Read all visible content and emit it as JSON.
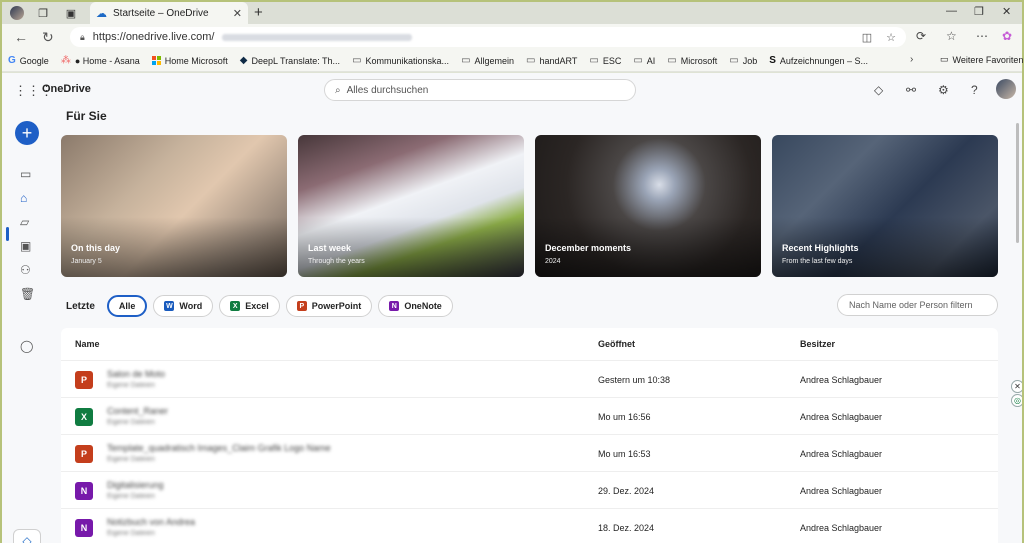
{
  "browser": {
    "tab_title": "Startseite – OneDrive",
    "url": "https://onedrive.live.com/",
    "bookmarks": [
      "Google",
      "● Home - Asana",
      "Home Microsoft",
      "DeepL Translate: Th...",
      "Kommunikationska...",
      "Allgemein",
      "handART",
      "ESC",
      "AI",
      "Microsoft",
      "Job",
      "Aufzeichnungen – S..."
    ],
    "bookmarks_more": "Weitere Favoriten"
  },
  "app": {
    "brand": "OneDrive",
    "search_placeholder": "Alles durchsuchen",
    "section_title": "Für Sie",
    "cards": [
      {
        "title": "On this day",
        "subtitle": "January 5"
      },
      {
        "title": "Last week",
        "subtitle": "Through the years"
      },
      {
        "title": "December moments",
        "subtitle": "2024"
      },
      {
        "title": "Recent Highlights",
        "subtitle": "From the last few days"
      }
    ],
    "recent_label": "Letzte",
    "filters": [
      "Alle",
      "Word",
      "Excel",
      "PowerPoint",
      "OneNote"
    ],
    "filter_placeholder": "Nach Name oder Person filtern",
    "columns": {
      "name": "Name",
      "opened": "Geöffnet",
      "owner": "Besitzer"
    },
    "files": [
      {
        "type": "PowerPoint",
        "icon": "P",
        "color": "#c43e1c",
        "name": "Salon de Moto",
        "location": "Eigene Dateien",
        "opened": "Gestern um 10:38",
        "owner": "Andrea Schlagbauer"
      },
      {
        "type": "Excel",
        "icon": "X",
        "color": "#107c41",
        "name": "Content_Raner",
        "location": "Eigene Dateien",
        "opened": "Mo um 16:56",
        "owner": "Andrea Schlagbauer"
      },
      {
        "type": "PowerPoint",
        "icon": "P",
        "color": "#c43e1c",
        "name": "Template_quadratisch Images_Claim Grafik Logo Name",
        "location": "Eigene Dateien",
        "opened": "Mo um 16:53",
        "owner": "Andrea Schlagbauer"
      },
      {
        "type": "OneNote",
        "icon": "N",
        "color": "#7719aa",
        "name": "Digitalisierung",
        "location": "Eigene Dateien",
        "opened": "29. Dez. 2024",
        "owner": "Andrea Schlagbauer"
      },
      {
        "type": "OneNote",
        "icon": "N",
        "color": "#7719aa",
        "name": "Notizbuch von Andrea",
        "location": "Eigene Dateien",
        "opened": "18. Dez. 2024",
        "owner": "Andrea Schlagbauer"
      }
    ]
  },
  "colors": {
    "accent": "#1e5fc6",
    "word": "#185abd",
    "excel": "#107c41",
    "powerpoint": "#c43e1c",
    "onenote": "#7719aa"
  }
}
